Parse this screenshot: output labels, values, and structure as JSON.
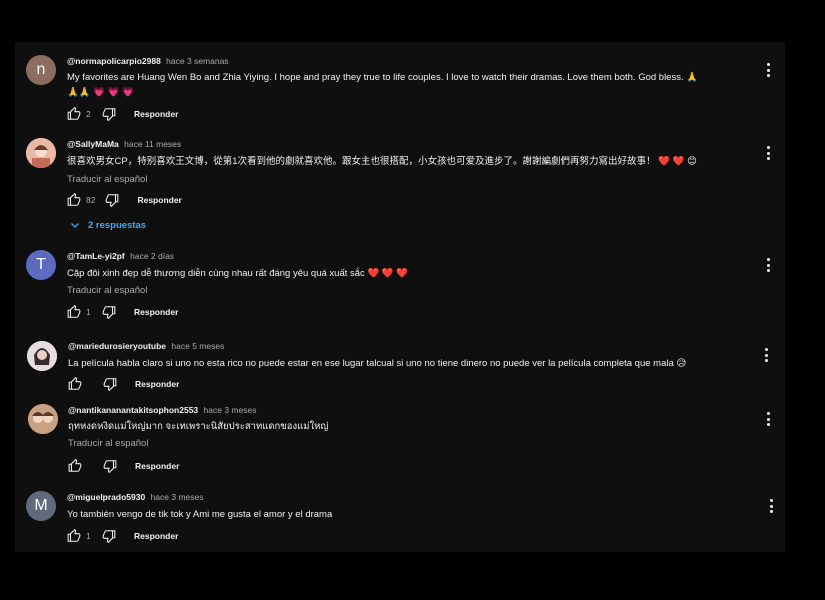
{
  "reply_label": "Responder",
  "translate_label": "Traducir al español",
  "comments": [
    {
      "avatar_letter": "n",
      "avatar_color": "#8b6e60",
      "handle": "@normapolicarpio2988",
      "time": "hace 3 semanas",
      "text_line1": "My favorites are Huang Wen Bo and Zhia Yiying. I hope and pray they true to life couples. I love to watch their  dramas. Love them both. God bless. 🙏",
      "text_line2": "🙏🙏 💗 💗 💗",
      "likes": "2"
    },
    {
      "avatar_letter": "",
      "avatar_color": "#d9a38c",
      "handle": "@SallyMaMa",
      "time": "hace 11 meses",
      "text_line1": "很喜欢男女CP，特别喜欢王文博，從第1次看到他的劇就喜欢他。跟女主也很搭配，小女孩也可爱及進步了。謝謝編劇們再努力寫出好故事！ ❤️ ❤️ 😊",
      "translate": true,
      "likes": "82",
      "replies": "2 respuestas"
    },
    {
      "avatar_letter": "T",
      "avatar_color": "#5c6bc0",
      "handle": "@TamLe-yi2pf",
      "time": "hace 2 días",
      "text_line1": "Cặp đôi xinh đẹp dễ thương diễn cùng nhau rất đáng yêu quá xuất sắc ❤️ ❤️ ❤️",
      "translate": true,
      "likes": "1"
    },
    {
      "avatar_letter": "",
      "avatar_color": "#c8b8c0",
      "handle": "@mariedurosieryoutube",
      "time": "hace 5 meses",
      "text_line1": "La película habla claro  si uno no esta rico no puede estar en ese lugar talcual si uno no tiene dinero no puede ver la película completa que mala 😥",
      "likes": ""
    },
    {
      "avatar_letter": "",
      "avatar_color": "#a0765a",
      "handle": "@nantikananantakitsophon2553",
      "time": "hace 3 meses",
      "text_line1": "ฤทหงดหงิดแม่ใหญ่มาก จะเทเพราะนิสัยประสาทแดกของแม่ใหญ่",
      "translate": true,
      "likes": ""
    },
    {
      "avatar_letter": "M",
      "avatar_color": "#5f6b7a",
      "handle": "@miguelprado5930",
      "time": "hace 3 meses",
      "text_line1": "Yo también vengo de tik tok y Ami me gusta el amor y el drama",
      "likes": "1"
    }
  ]
}
